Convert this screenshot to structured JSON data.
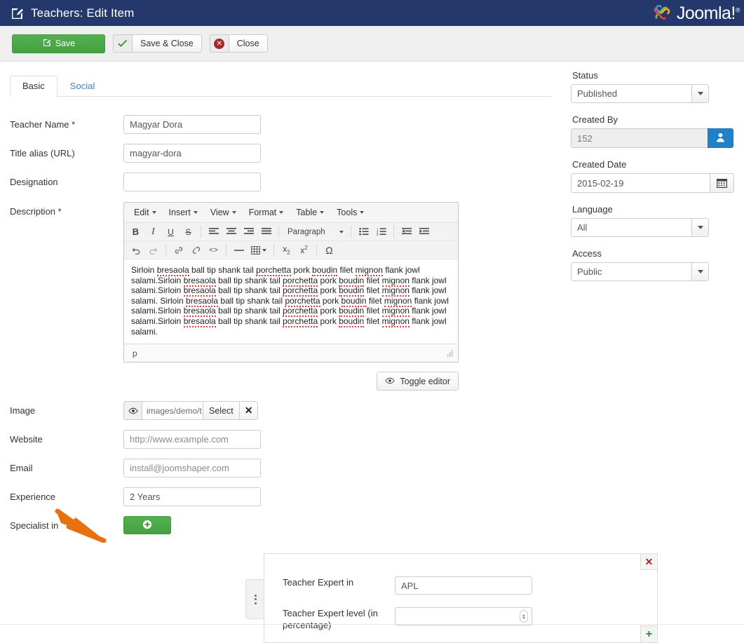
{
  "header": {
    "title": "Teachers: Edit Item",
    "edit_icon": "pencil-square-icon",
    "brand": "Joomla!",
    "brand_sup": "®",
    "bg_color": "#24386b"
  },
  "toolbar": {
    "save_label": "Save",
    "save_icon": "pencil-square-icon",
    "save_close_label": "Save & Close",
    "save_close_icon": "check-icon",
    "close_label": "Close",
    "close_icon": "x-circle-icon",
    "accent_green": "#48a545",
    "danger_red": "#a62b2b"
  },
  "tabs": [
    {
      "label": "Basic",
      "active": true
    },
    {
      "label": "Social",
      "active": false
    }
  ],
  "form": {
    "teacher_name": {
      "label": "Teacher Name *",
      "value": "Magyar Dora"
    },
    "title_alias": {
      "label": "Title alias (URL)",
      "value": "magyar-dora"
    },
    "designation": {
      "label": "Designation",
      "value": ""
    },
    "description": {
      "label": "Description *"
    },
    "image": {
      "label": "Image",
      "preview_icon": "eye-icon",
      "path": "images/demo/t",
      "select_label": "Select",
      "clear_icon": "x-icon"
    },
    "website": {
      "label": "Website",
      "placeholder": "http://www.example.com"
    },
    "email": {
      "label": "Email",
      "placeholder": "install@joomshaper.com"
    },
    "experience": {
      "label": "Experience",
      "value": "2 Years"
    },
    "specialist_in": {
      "label": "Specialist in",
      "add_icon": "plus-circle-icon"
    }
  },
  "editor": {
    "menubar": [
      {
        "label": "Edit"
      },
      {
        "label": "Insert"
      },
      {
        "label": "View"
      },
      {
        "label": "Format"
      },
      {
        "label": "Table"
      },
      {
        "label": "Tools"
      }
    ],
    "toolbar_row1": [
      {
        "icon": "bold-icon",
        "glyph": "B"
      },
      {
        "icon": "italic-icon",
        "glyph": "I"
      },
      {
        "icon": "underline-icon",
        "glyph": "U"
      },
      {
        "icon": "strikethrough-icon",
        "glyph": "S"
      },
      {
        "icon": "align-left-icon"
      },
      {
        "icon": "align-center-icon"
      },
      {
        "icon": "align-right-icon"
      },
      {
        "icon": "align-justify-icon"
      }
    ],
    "format_select": "Paragraph",
    "toolbar_row1b": [
      {
        "icon": "bullet-list-icon"
      },
      {
        "icon": "numbered-list-icon"
      },
      {
        "icon": "outdent-icon"
      },
      {
        "icon": "indent-icon"
      }
    ],
    "toolbar_row2": [
      {
        "icon": "undo-icon"
      },
      {
        "icon": "redo-icon"
      },
      {
        "icon": "link-icon"
      },
      {
        "icon": "unlink-icon"
      },
      {
        "icon": "source-code-icon",
        "glyph": "<>"
      },
      {
        "icon": "horizontal-rule-icon"
      },
      {
        "icon": "table-icon"
      },
      {
        "icon": "subscript-icon"
      },
      {
        "icon": "superscript-icon"
      },
      {
        "icon": "special-character-icon",
        "glyph": "Ω"
      }
    ],
    "body_text": "Sirloin bresaola ball tip shank tail porchetta pork boudin filet mignon flank jowl salami.Sirloin bresaola ball tip shank tail porchetta pork boudin filet mignon flank jowl salami.Sirloin bresaola ball tip shank tail porchetta pork boudin filet mignon flank jowl salami. Sirloin bresaola ball tip shank tail porchetta pork boudin filet mignon flank jowl salami.Sirloin bresaola ball tip shank tail porchetta pork boudin filet mignon flank jowl salami.Sirloin bresaola ball tip shank tail porchetta pork boudin filet mignon flank jowl salami.",
    "status_path": "p",
    "toggle_editor_label": "Toggle editor",
    "toggle_editor_icon": "eye-icon"
  },
  "repeatable": {
    "drag_handle_icon": "drag-dots-icon",
    "remove_icon": "x-icon",
    "add_icon": "plus-icon",
    "fields": [
      {
        "label": "Teacher Expert in",
        "value": "APL",
        "type": "text"
      },
      {
        "label": "Teacher Expert level (in percentage)",
        "value": "",
        "type": "number"
      }
    ]
  },
  "sidebar": {
    "status": {
      "label": "Status",
      "value": "Published"
    },
    "created_by": {
      "label": "Created By",
      "value": "152",
      "button_icon": "user-icon",
      "button_color": "#2081c9"
    },
    "created_date": {
      "label": "Created Date",
      "value": "2015-02-19",
      "button_icon": "calendar-icon"
    },
    "language": {
      "label": "Language",
      "value": "All"
    },
    "access": {
      "label": "Access",
      "value": "Public"
    }
  },
  "annotation": {
    "arrow_color": "#e8710f",
    "points_to": "Specialist in"
  }
}
